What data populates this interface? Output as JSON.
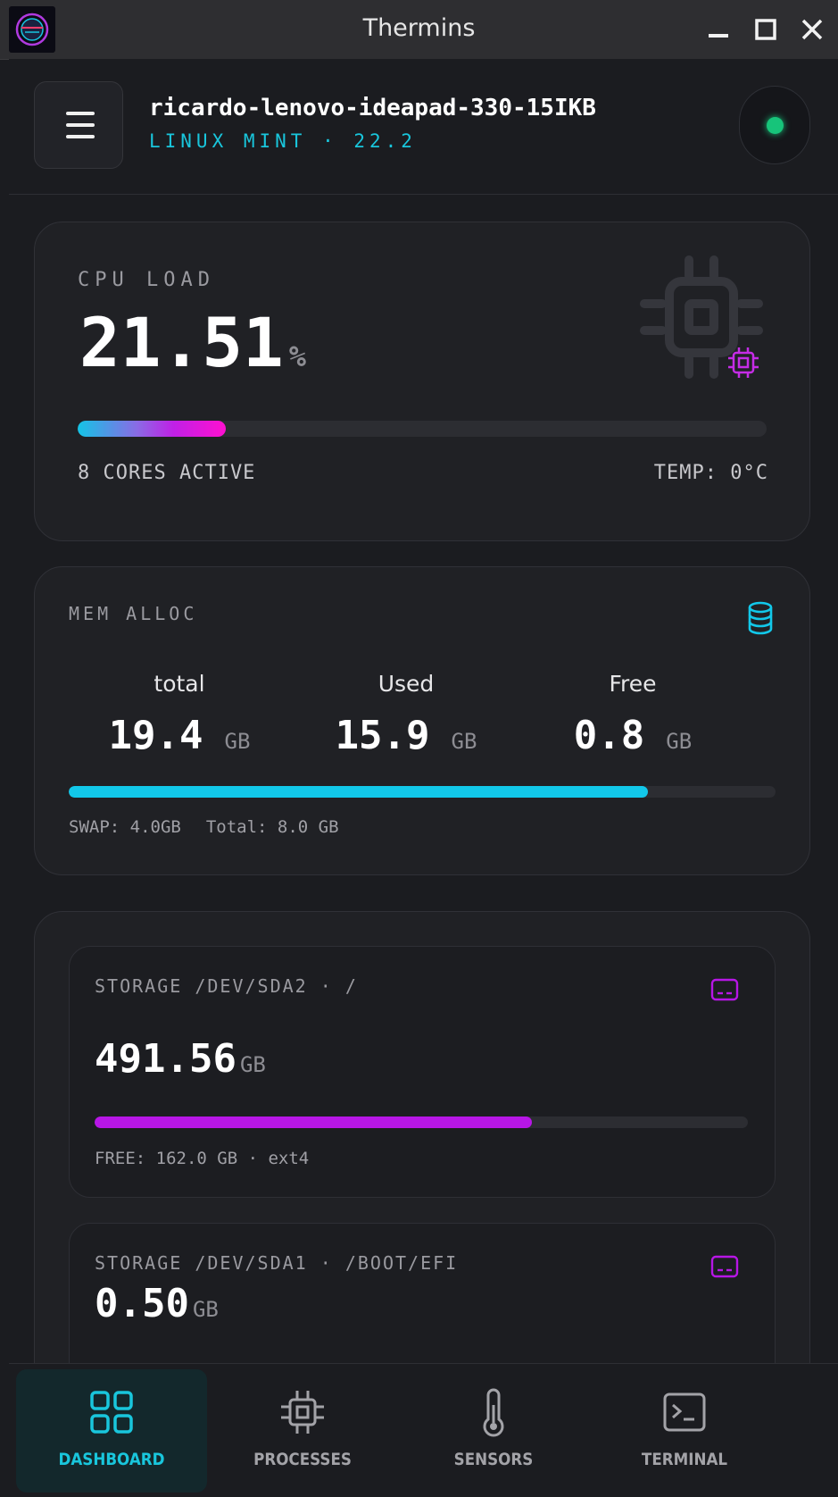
{
  "window": {
    "title": "Thermins"
  },
  "header": {
    "hostname": "ricardo-lenovo-ideapad-330-15IKB",
    "distro": "LINUX MINT · 22.2",
    "status_color": "#17c47a"
  },
  "cpu": {
    "label": "CPU LOAD",
    "value": "21.51",
    "unit": "%",
    "load_percent": 21.51,
    "cores": "8 CORES ACTIVE",
    "temp": "TEMP: 0°C",
    "icon": "cpu-chip-icon"
  },
  "memory": {
    "label": "MEM ALLOC",
    "icon": "database-icon",
    "total_label": "total",
    "total_value": "19.4",
    "used_label": "Used",
    "used_value": "15.9",
    "free_label": "Free",
    "free_value": "0.8",
    "unit": "GB",
    "used_fraction": 0.82,
    "swap": "SWAP: 4.0GB",
    "swap_total": "Total: 8.0 GB"
  },
  "storage": [
    {
      "label": "STORAGE /DEV/SDA2 · /",
      "value": "491.56",
      "unit": "GB",
      "used_fraction": 0.67,
      "free": "FREE: 162.0 GB · ext4",
      "icon": "hard-drive-icon"
    },
    {
      "label": "STORAGE /DEV/SDA1 · /BOOT/EFI",
      "value": "0.50",
      "unit": "GB",
      "icon": "hard-drive-icon"
    }
  ],
  "nav": [
    {
      "label": "DASHBOARD",
      "icon": "grid-icon",
      "active": true
    },
    {
      "label": "PROCESSES",
      "icon": "cpu-icon"
    },
    {
      "label": "SENSORS",
      "icon": "thermometer-icon"
    },
    {
      "label": "TERMINAL",
      "icon": "terminal-icon"
    }
  ],
  "colors": {
    "accent": "#19c6dc",
    "magenta": "#b716e6",
    "background": "#1b1c20"
  }
}
